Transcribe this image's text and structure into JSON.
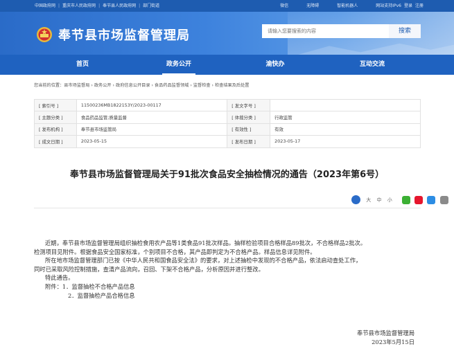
{
  "top_links": {
    "gov_cn": "中国政府网",
    "chongqing": "重庆市人民政府网",
    "fengjie": "奉节县人民政府网",
    "dept": "部门街道",
    "weibo": "微信",
    "accessible": "无障碍",
    "robot": "智能机器人",
    "ipv6": "网站支持IPv6",
    "login": "登录",
    "register": "注册"
  },
  "site": {
    "title": "奉节县市场监督管理局"
  },
  "search": {
    "placeholder": "请输入您要搜索的内容",
    "button": "搜索"
  },
  "nav": {
    "items": [
      "首页",
      "政务公开",
      "渝快办",
      "互动交流"
    ],
    "active": "政务公开"
  },
  "breadcrumb": "您当前的位置：县市场监督局 › 政务公开 › 政府信息公开目录 › 食品药品监督领域 › 监督检查 › 检查结果及后处置",
  "meta": {
    "index_no_label": "[ 索引号 ]",
    "index_no": "11500236MB1822153Y/2023-00117",
    "doc_no_label": "[ 发文字号 ]",
    "doc_no": "",
    "topic_label": "[ 主题分类 ]",
    "topic": "食品药品监管;质量监督",
    "genre_label": "[ 体裁分类 ]",
    "genre": "行政监管",
    "issuer_label": "[ 发布机构 ]",
    "issuer": "奉节县市场监管局",
    "validity_label": "[ 有效性 ]",
    "validity": "有效",
    "created_label": "[ 成文日期 ]",
    "created": "2023-05-15",
    "published_label": "[ 发布日期 ]",
    "published": "2023-05-17"
  },
  "document": {
    "title": "奉节县市场监督管理局关于91批次食品安全抽检情况的通告（2023年第6号）",
    "font_large": "大",
    "font_medium": "中",
    "font_small": "小",
    "para1_line1": "近期，奉节县市场监督管理局组织抽检食用农产品等1类食品91批次样品。抽样检验项目合格样品89批次，不合格样品2批次。",
    "para1_line2": "检测项目见附件。根据食品安全国家标准，个别项目不合格，其产品即判定为不合格产品。样品信息详见附件。",
    "para2_line1": "所在地市场监督管理部门已按《中华人民共和国食品安全法》的要求，对上述抽检中发现的不合格产品，依法启动查处工作，",
    "para2_line2": "同时已采取风险控制措施，查清产品流向，召回、下架不合格产品，分析原因并进行整改。",
    "notice": "特此通告。",
    "attachment1": "附件：1．监督抽检不合格产品信息",
    "attachment2": "2．监督抽检产品合格信息",
    "sign_org": "奉节县市场监督管理局",
    "sign_date": "2023年5月15日"
  },
  "colors": {
    "primary": "#1f62c0",
    "topbar": "#1e5cb0",
    "wechat": "#3cb034",
    "weibo": "#e6162d",
    "qq": "#2c8de4"
  },
  "icons": [
    "emblem-icon",
    "font-size-icon",
    "wechat-icon",
    "weibo-icon",
    "qzone-icon",
    "print-icon"
  ]
}
